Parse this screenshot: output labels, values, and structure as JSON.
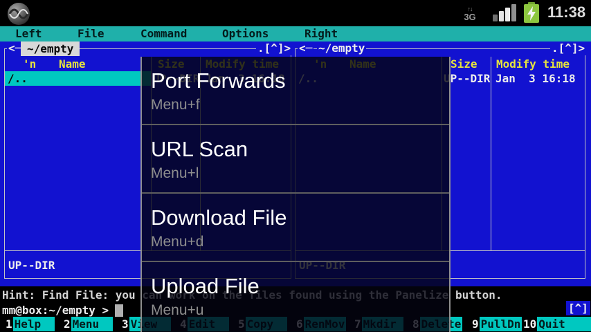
{
  "colors": {
    "panel_blue": "#1212d0",
    "menubar_teal": "#1fb0aa",
    "accent_cyan": "#00c8c0",
    "header_yellow": "#e6e33e",
    "battery_green": "#8dc63f"
  },
  "status_bar": {
    "time": "11:38",
    "network_type": "3G",
    "network_arrows": "↑↓"
  },
  "mc": {
    "menu": [
      "Left",
      "File",
      "Command",
      "Options",
      "Right"
    ],
    "left_panel": {
      "arrow": "<─",
      "title": "~/empty",
      "corner": ".[^]>",
      "cols": {
        "mark": "'n",
        "name": "Name",
        "size": "Size",
        "mtime": "Modify time"
      },
      "row": {
        "name": "/..",
        "size": "UP--DIR",
        "mtime": "Jan  3 16:18"
      },
      "mini_status": "UP--DIR"
    },
    "right_panel": {
      "arrow": "<─",
      "title": "~/empty",
      "corner": ".[^]>",
      "cols": {
        "mark": "'n",
        "name": "Name",
        "size": "Size",
        "mtime": "Modify time"
      },
      "row": {
        "name": "/..",
        "size": "UP--DIR",
        "mtime": "Jan  3 16:18"
      },
      "mini_status": "UP--DIR"
    },
    "hint": "Hint: Find File: you can work on the files found using the Panelize button.",
    "prompt": "mm@box:~/empty >",
    "scroll_tag": "[^]",
    "fkeys": [
      {
        "num": "1",
        "label": "Help"
      },
      {
        "num": "2",
        "label": "Menu"
      },
      {
        "num": "3",
        "label": "View"
      },
      {
        "num": "4",
        "label": "Edit"
      },
      {
        "num": "5",
        "label": "Copy"
      },
      {
        "num": "6",
        "label": "RenMov"
      },
      {
        "num": "7",
        "label": "Mkdir"
      },
      {
        "num": "8",
        "label": "Delete"
      },
      {
        "num": "9",
        "label": "PullDn"
      },
      {
        "num": "10",
        "label": "Quit"
      }
    ]
  },
  "context_menu": {
    "items": [
      {
        "label": "Port Forwards",
        "shortcut": "Menu+f"
      },
      {
        "label": "URL Scan",
        "shortcut": "Menu+l"
      },
      {
        "label": "Download File",
        "shortcut": "Menu+d"
      },
      {
        "label": "Upload File",
        "shortcut": "Menu+u"
      }
    ]
  }
}
